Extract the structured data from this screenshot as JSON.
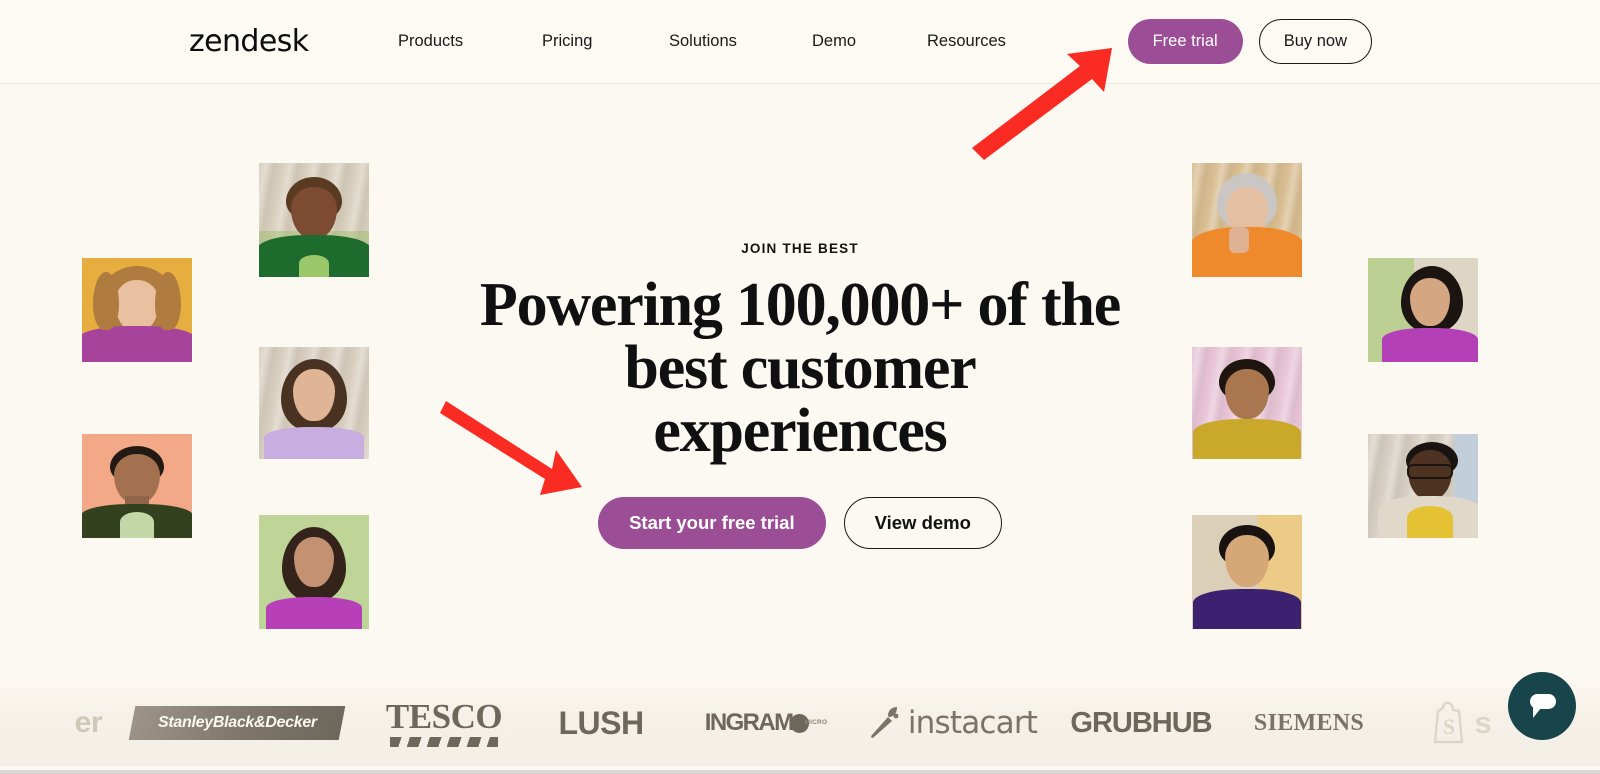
{
  "header": {
    "brand": "zendesk",
    "nav": [
      {
        "label": "Products",
        "id": "products"
      },
      {
        "label": "Pricing",
        "id": "pricing"
      },
      {
        "label": "Solutions",
        "id": "solutions"
      },
      {
        "label": "Demo",
        "id": "demo"
      },
      {
        "label": "Resources",
        "id": "resources"
      }
    ],
    "free_trial_label": "Free trial",
    "buy_now_label": "Buy now"
  },
  "hero": {
    "eyebrow": "JOIN THE BEST",
    "headline_line1": "Powering 100,000+ of the",
    "headline_line2": "best customer",
    "headline_line3": "experiences",
    "headline_full": "Powering 100,000+ of the best customer experiences",
    "cta_primary": "Start your free trial",
    "cta_secondary": "View demo"
  },
  "annotations": [
    {
      "name": "arrow-to-free-trial",
      "color": "#FA2B22",
      "direction": "up-right",
      "target": "Free trial"
    },
    {
      "name": "arrow-to-start-trial",
      "color": "#FA2B22",
      "direction": "down-right",
      "target": "Start your free trial"
    }
  ],
  "photos": [
    {
      "id": "p1",
      "bg": "#E6AD3F",
      "skin": "#E9C0A0",
      "hair": "#B07B3E",
      "clothes": "#A8439C",
      "drape": false
    },
    {
      "id": "p2",
      "bg": "#CFC6B4",
      "skin": "#7C4B32",
      "hair": "#5A3A20",
      "clothes": "#1E6B2E",
      "drape": true
    },
    {
      "id": "p3",
      "bg": "#F3A987",
      "skin": "#A3714F",
      "hair": "#221A13",
      "clothes": "#33411F",
      "drape": false
    },
    {
      "id": "p4",
      "bg": "#D9CFC0",
      "skin": "#DFB595",
      "hair": "#4A3223",
      "clothes": "#C8AEE0",
      "drape": true
    },
    {
      "id": "p5",
      "bg": "#BFD497",
      "skin": "#C49273",
      "hair": "#33231A",
      "clothes": "#B740B8",
      "drape": false
    },
    {
      "id": "p6",
      "bg": "#D9BE92",
      "skin": "#E4BFA2",
      "hair": "#C9C6C4",
      "clothes": "#EE8A2B",
      "drape": true
    },
    {
      "id": "p7",
      "bg": "#E8C5D7",
      "skin": "#A9764F",
      "hair": "#1E150F",
      "clothes": "#C9A82A",
      "drape": true
    },
    {
      "id": "p8",
      "bg": "#EBCB86",
      "skin": "#D6A878",
      "hair": "#191210",
      "clothes": "#3B2170",
      "drape": true
    },
    {
      "id": "p9",
      "bg": "#BCCF92",
      "skin": "#D4A682",
      "hair": "#1B1410",
      "clothes": "#B340B6",
      "drape": true
    },
    {
      "id": "p10",
      "bg": "#D7CFC4",
      "skin": "#4F3322",
      "hair": "#1A1410",
      "clothes": "#E4C234",
      "drape": true
    }
  ],
  "logo_bar": {
    "logos": [
      {
        "name": "uber",
        "text": "er"
      },
      {
        "name": "stanley-black-decker",
        "text": "StanleyBlack&Decker"
      },
      {
        "name": "tesco",
        "text": "TESCO"
      },
      {
        "name": "lush",
        "text": "LUSH"
      },
      {
        "name": "ingram-micro",
        "text": "INGRAM",
        "sub1": "MICRO",
        "sub2": ""
      },
      {
        "name": "instacart",
        "text": "instacart"
      },
      {
        "name": "grubhub",
        "text": "GRUBHUB"
      },
      {
        "name": "siemens",
        "text": "SIEMENS"
      },
      {
        "name": "shopify",
        "text": "s"
      }
    ]
  },
  "chat": {
    "icon": "chat-bubble-icon",
    "color": "#17454B"
  },
  "theme": {
    "page_bg": "#FCF8F2",
    "header_bg": "#FDF9F3",
    "accent_purple": "#9B4D96",
    "text_dark": "#111010",
    "annotation_red": "#FA2B22"
  }
}
